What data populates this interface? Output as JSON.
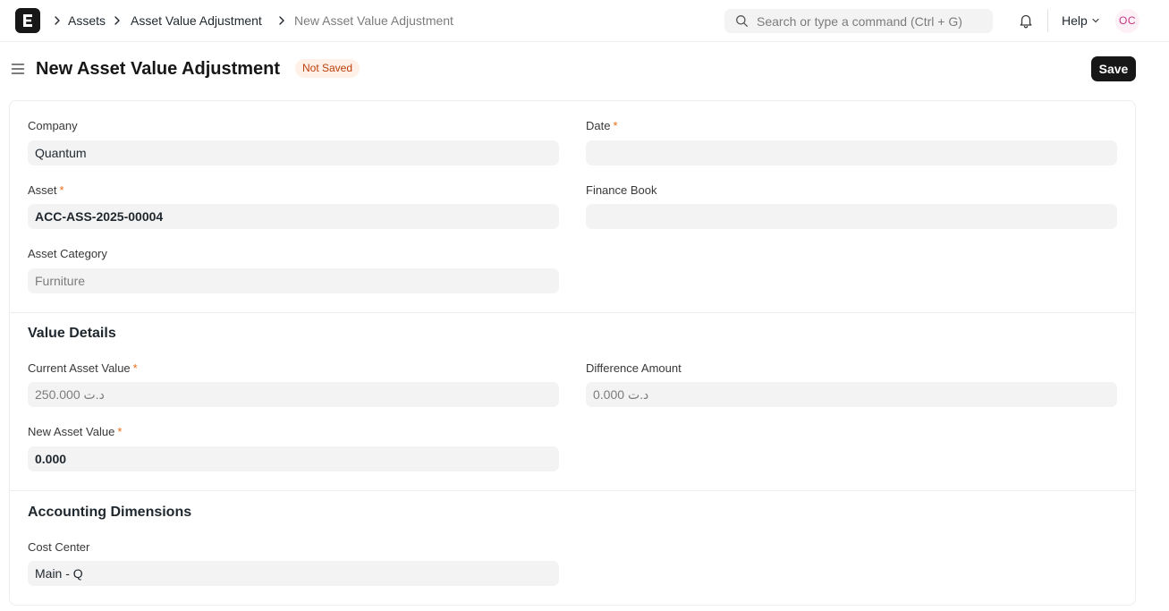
{
  "navbar": {
    "logo_letter": "E",
    "breadcrumbs": [
      {
        "label": "Assets"
      },
      {
        "label": "Asset Value Adjustment"
      },
      {
        "label": "New Asset Value Adjustment"
      }
    ],
    "search_placeholder": "Search or type a command (Ctrl + G)",
    "help_label": "Help",
    "avatar_initials": "OC"
  },
  "page": {
    "title": "New Asset Value Adjustment",
    "status": "Not Saved",
    "save_label": "Save"
  },
  "form": {
    "company": {
      "label": "Company",
      "value": "Quantum"
    },
    "date": {
      "label": "Date",
      "value": "",
      "required": "*"
    },
    "asset": {
      "label": "Asset",
      "value": "ACC-ASS-2025-00004",
      "required": "*"
    },
    "finance_book": {
      "label": "Finance Book",
      "value": ""
    },
    "asset_category": {
      "label": "Asset Category",
      "value": "Furniture"
    },
    "value_details": {
      "heading": "Value Details",
      "current_asset_value": {
        "label": "Current Asset Value",
        "value": "250.000 د.ت",
        "required": "*"
      },
      "difference_amount": {
        "label": "Difference Amount",
        "value": "0.000 د.ت"
      },
      "new_asset_value": {
        "label": "New Asset Value",
        "value": "0.000",
        "required": "*"
      }
    },
    "accounting_dimensions": {
      "heading": "Accounting Dimensions",
      "cost_center": {
        "label": "Cost Center",
        "value": "Main - Q"
      }
    }
  },
  "colors": {
    "accent": "#171717",
    "required_mark": "#e86c13",
    "badge_bg": "#fff1e7",
    "badge_text": "#bd3e0c",
    "input_bg": "#f3f3f3"
  },
  "icons": [
    "frappe-logo-icon",
    "chevron-right-icon",
    "search-icon",
    "bell-icon",
    "chevron-down-icon",
    "sidebar-toggle-icon"
  ]
}
